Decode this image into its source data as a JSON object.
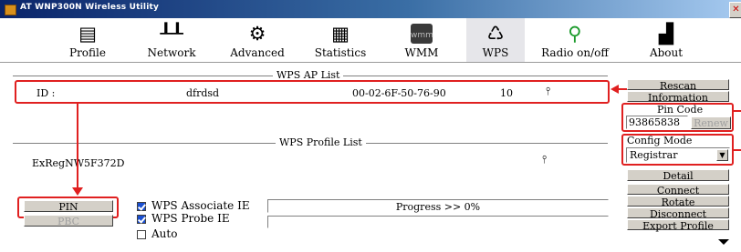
{
  "window": {
    "title": "AT WNP300N Wireless Utility",
    "close_glyph": "✕"
  },
  "toolbar": {
    "items": [
      {
        "label": "Profile",
        "icon": "profile-icon"
      },
      {
        "label": "Network",
        "icon": "network-icon"
      },
      {
        "label": "Advanced",
        "icon": "advanced-icon"
      },
      {
        "label": "Statistics",
        "icon": "statistics-icon"
      },
      {
        "label": "WMM",
        "icon": "wmm-icon"
      },
      {
        "label": "WPS",
        "icon": "wps-icon",
        "active": true
      },
      {
        "label": "Radio on/off",
        "icon": "radio-icon"
      },
      {
        "label": "About",
        "icon": "about-icon"
      }
    ]
  },
  "ap_list": {
    "title": "WPS AP List",
    "row": {
      "id_label": "ID :",
      "ssid": "dfrdsd",
      "bssid": "00-02-6F-50-76-90",
      "channel": "10"
    }
  },
  "profile_list": {
    "title": "WPS Profile List",
    "row": {
      "name": "ExRegNW5F372D"
    }
  },
  "side": {
    "rescan": "Rescan",
    "information": "Information",
    "pin_code_label": "Pin Code",
    "pin_code_value": "93865838",
    "renew": "Renew",
    "config_mode_label": "Config Mode",
    "config_mode_value": "Registrar",
    "detail": "Detail",
    "connect": "Connect",
    "rotate": "Rotate",
    "disconnect": "Disconnect",
    "export_profile": "Export Profile"
  },
  "bottom": {
    "pin_button": "PIN",
    "pbc_button": "PBC",
    "wps_associate_ie": "WPS Associate IE",
    "wps_probe_ie": "WPS Probe IE",
    "auto": "Auto",
    "progress_text": "Progress >> 0%",
    "progress": 0
  },
  "colors": {
    "highlight": "#e02020",
    "title_bar": "#0a246a",
    "button_face": "#d4d0c8"
  }
}
